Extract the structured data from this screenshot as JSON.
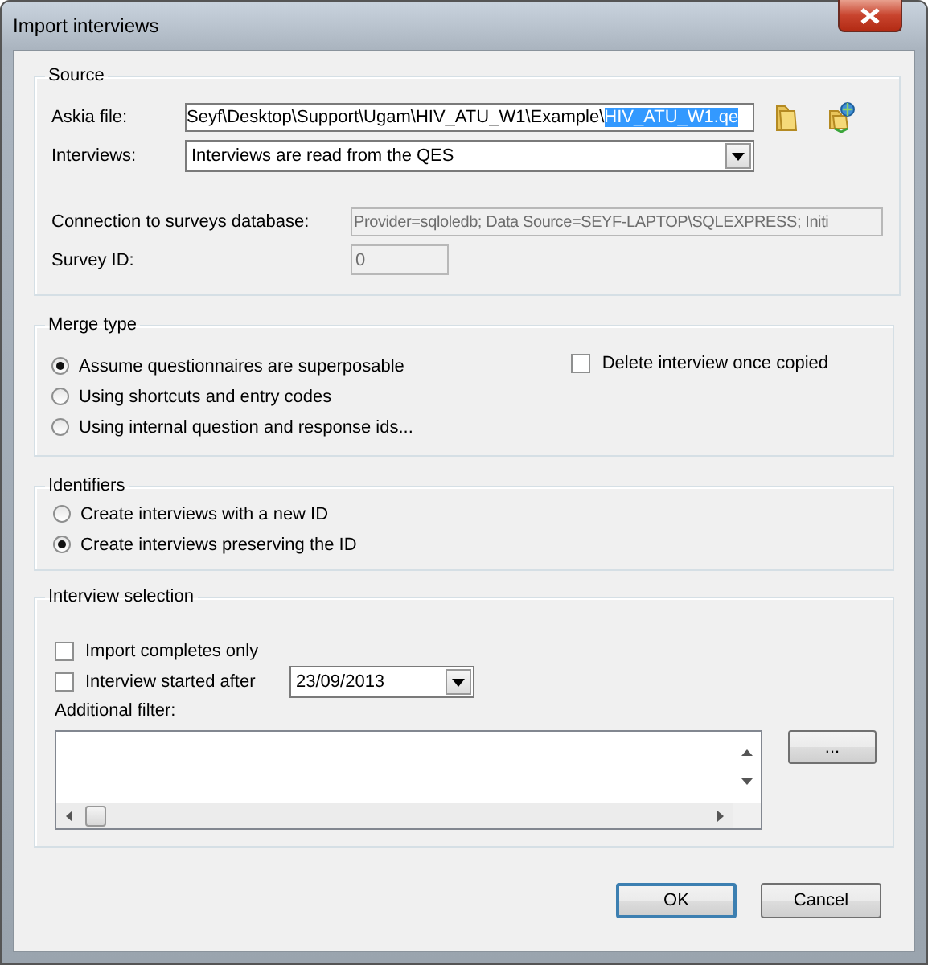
{
  "window": {
    "title": "Import interviews"
  },
  "source": {
    "title": "Source",
    "askia_file": {
      "label": "Askia file:",
      "value": "Seyf\\Desktop\\Support\\Ugam\\HIV_ATU_W1\\Example\\",
      "selected_text": "HIV_ATU_W1.qe"
    },
    "interviews": {
      "label": "Interviews:",
      "value": "Interviews are read from the QES"
    },
    "connection": {
      "label": "Connection to surveys database:",
      "value": "Provider=sqloledb; Data Source=SEYF-LAPTOP\\SQLEXPRESS; Initi",
      "disabled": true
    },
    "survey_id": {
      "label": "Survey ID:",
      "value": "0",
      "disabled": true
    }
  },
  "merge_type": {
    "title": "Merge type",
    "options": [
      {
        "label": "Assume questionnaires are superposable",
        "selected": true
      },
      {
        "label": "Using shortcuts and entry codes",
        "selected": false
      },
      {
        "label": "Using internal question and response ids...",
        "selected": false
      }
    ],
    "delete_copied": {
      "label": "Delete interview once copied",
      "checked": false
    }
  },
  "identifiers": {
    "title": "Identifiers",
    "options": [
      {
        "label": "Create interviews with a new ID",
        "selected": false
      },
      {
        "label": "Create interviews preserving the ID",
        "selected": true
      }
    ]
  },
  "interview_selection": {
    "title": "Interview selection",
    "import_completes": {
      "label": "Import completes only",
      "checked": false
    },
    "started_after": {
      "label": "Interview started after",
      "checked": false,
      "date": "23/09/2013"
    },
    "filter_label": "Additional filter:",
    "browse_button": "..."
  },
  "buttons": [
    {
      "label": "OK",
      "default": true
    },
    {
      "label": "Cancel",
      "default": false
    }
  ]
}
